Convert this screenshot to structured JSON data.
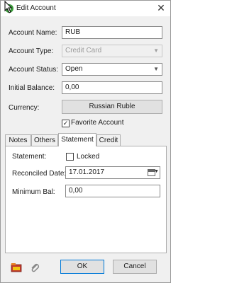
{
  "window": {
    "title": "Edit Account",
    "app_icon": "$",
    "close": "✕"
  },
  "form": {
    "account_name": {
      "label": "Account Name:",
      "value": "RUB"
    },
    "account_type": {
      "label": "Account Type:",
      "value": "Credit Card",
      "disabled": true
    },
    "account_status": {
      "label": "Account Status:",
      "value": "Open"
    },
    "initial_balance": {
      "label": "Initial Balance:",
      "value": "0,00"
    },
    "currency": {
      "label": "Currency:",
      "button": "Russian Ruble"
    },
    "favorite": {
      "label": "Favorite Account",
      "checked": true
    }
  },
  "tabs": [
    {
      "label": "Notes",
      "active": false
    },
    {
      "label": "Others",
      "active": false
    },
    {
      "label": "Statement",
      "active": true
    },
    {
      "label": "Credit",
      "active": false
    }
  ],
  "statement": {
    "statement_label": "Statement:",
    "locked_label": "Locked",
    "locked_checked": false,
    "reconciled_label": "Reconciled Date:",
    "reconciled_value": "17.01.2017",
    "min_bal_label": "Minimum Bal:",
    "min_bal_value": "0,00"
  },
  "buttons": {
    "ok": "OK",
    "cancel": "Cancel"
  },
  "icons": {
    "folder": "folder-icon",
    "attachment": "attachment-icon",
    "calendar": "calendar-icon"
  }
}
